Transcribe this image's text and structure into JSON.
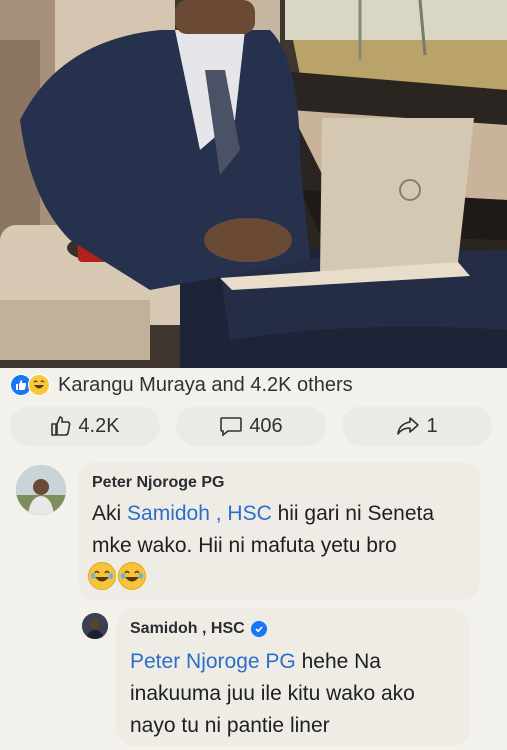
{
  "post": {
    "reactions_text": "Karangu Muraya and 4.2K others",
    "like_count": "4.2K",
    "comment_count": "406",
    "share_count": "1"
  },
  "comments": [
    {
      "author": "Peter Njoroge PG",
      "mention": "Samidoh , HSC",
      "text_before": "Aki ",
      "text_after": " hii gari ni Seneta mke wako. Hii ni mafuta yetu bro"
    },
    {
      "author": "Samidoh , HSC",
      "mention": "Peter Njoroge PG",
      "text_after": "  hehe Na inakuuma juu ile kitu wako ako nayo tu ni pantie liner"
    }
  ],
  "colors": {
    "mention": "#2a6fc9",
    "like_blue": "#1877f2",
    "haha_yellow": "#f7c83b"
  }
}
